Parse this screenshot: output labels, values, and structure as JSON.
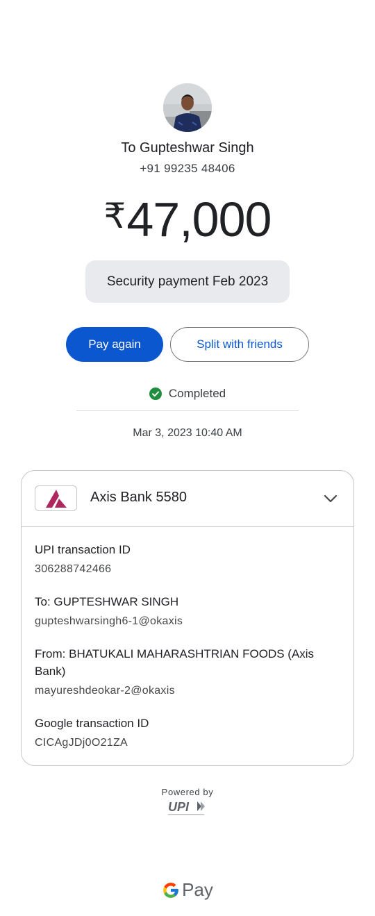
{
  "recipient": {
    "name_line": "To Gupteshwar Singh",
    "phone": "+91 99235 48406"
  },
  "payment": {
    "currency_symbol": "₹",
    "amount": "47,000",
    "note": "Security payment Feb 2023"
  },
  "actions": {
    "pay_again": "Pay again",
    "split": "Split with friends"
  },
  "status": {
    "label": "Completed",
    "icon": "check-circle-icon",
    "color": "#1e8e3e"
  },
  "datetime": "Mar 3, 2023 10:40 AM",
  "details": {
    "bank_label": "Axis Bank 5580",
    "bank_logo_color": "#ae275f",
    "fields": [
      {
        "label": "UPI transaction ID",
        "value": "306288742466"
      },
      {
        "label": "To: GUPTESHWAR SINGH",
        "value": "gupteshwarsingh6-1@okaxis"
      },
      {
        "label": "From: BHATUKALI MAHARASHTRIAN FOODS (Axis Bank)",
        "value": "mayureshdeokar-2@okaxis"
      },
      {
        "label": "Google transaction ID",
        "value": "CICAgJDj0O21ZA"
      }
    ]
  },
  "footer": {
    "powered_by": "Powered by",
    "upi_logo": "UPI",
    "brand": "Pay"
  },
  "colors": {
    "primary": "#0b57d0",
    "chip_bg": "#e8eaed"
  }
}
